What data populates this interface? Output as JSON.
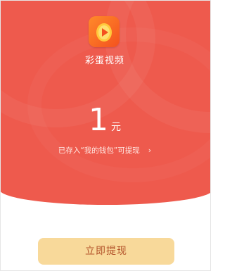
{
  "app": {
    "name": "彩蛋视频",
    "logo_icon": "video-egg-icon",
    "logo_colors": {
      "from": "#ff8a2a",
      "to": "#f4511e",
      "egg": "#ffc93c"
    }
  },
  "reward": {
    "amount": "1",
    "unit": "元",
    "note": "已存入“我的钱包”可提现",
    "note_chevron": "›"
  },
  "actions": {
    "withdraw_label": "立即提现"
  },
  "colors": {
    "panel_red": "#ee5a4d",
    "button_bg": "#f8d99a",
    "button_text": "#b3532a"
  }
}
